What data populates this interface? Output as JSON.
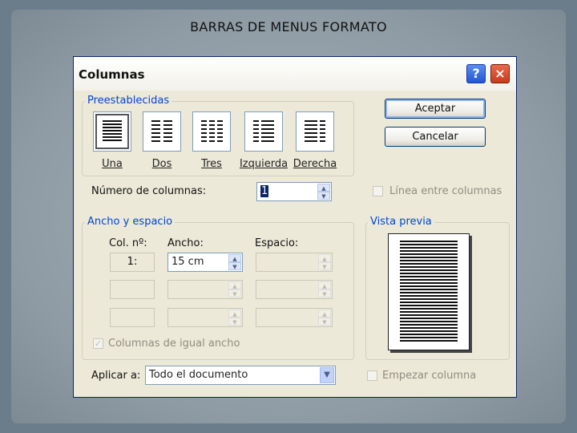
{
  "slide": {
    "title": "BARRAS DE MENUS FORMATO"
  },
  "dialog": {
    "title": "Columnas",
    "help_glyph": "?",
    "close_glyph": "×",
    "presets": {
      "group_label": "Preestablecidas",
      "items": [
        {
          "label": "Una"
        },
        {
          "label": "Dos"
        },
        {
          "label": "Tres"
        },
        {
          "label": "Izquierda"
        },
        {
          "label": "Derecha"
        }
      ],
      "selected": "Una"
    },
    "buttons": {
      "accept": "Aceptar",
      "cancel": "Cancelar"
    },
    "num_columns": {
      "label": "Número de columnas:",
      "value": "1"
    },
    "line_between": {
      "label": "Línea entre columnas",
      "checked": false
    },
    "width_spacing": {
      "group_label": "Ancho y espacio",
      "col_header": "Col. nº:",
      "width_header": "Ancho:",
      "spacing_header": "Espacio:",
      "row1": {
        "col": "1:",
        "width": "15 cm",
        "spacing": ""
      }
    },
    "equal_width": {
      "label": "Columnas de igual ancho",
      "checked": true
    },
    "preview": {
      "group_label": "Vista previa"
    },
    "apply_to": {
      "label": "Aplicar a:",
      "value": "Todo el documento"
    },
    "start_column": {
      "label": "Empezar columna",
      "checked": false
    },
    "colors": {
      "accent": "#0046d5",
      "border": "#7f9db9"
    }
  }
}
